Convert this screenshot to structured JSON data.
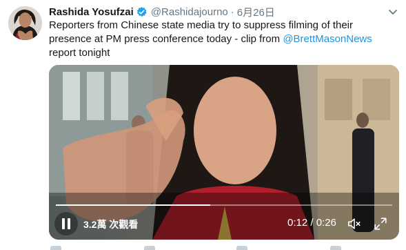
{
  "tweet": {
    "author_name": "Rashida Yosufzai",
    "handle": "@Rashidajourno",
    "separator": "·",
    "date": "6月26日",
    "text_before_mention": "Reporters from Chinese state media try to suppress filming of their presence at PM press conference today - clip from ",
    "mention": "@BrettMasonNews",
    "text_after_mention": " report tonight"
  },
  "video": {
    "views_label": "3.2萬 次觀看",
    "time_label": "0:12 / 0:26",
    "progress": 0.46
  },
  "icons": {
    "verified": "verified-badge-icon",
    "caret": "chevron-down-icon",
    "pause": "pause-icon",
    "volume": "volume-icon",
    "fullscreen": "fullscreen-icon"
  },
  "colors": {
    "link": "#1b95e0",
    "verified": "#1da1f2",
    "muted": "#657786"
  }
}
